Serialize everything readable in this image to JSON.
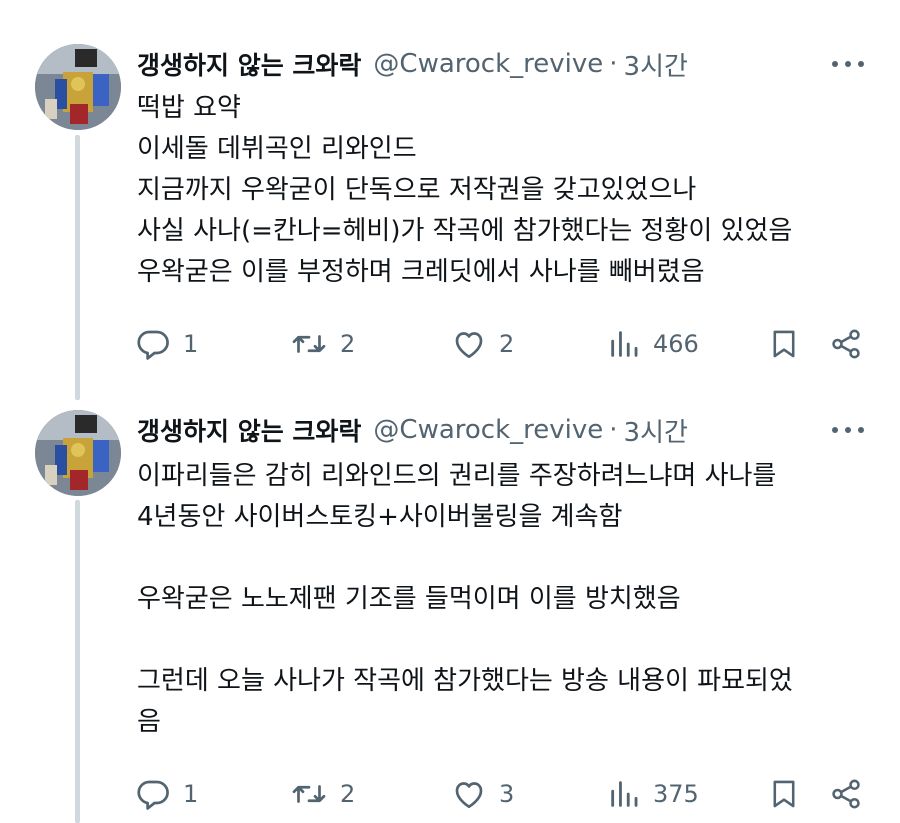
{
  "tweets": [
    {
      "name": "갱생하지 않는 크와락",
      "handle": "@Cwarock_revive",
      "separator": "·",
      "time": "3시간",
      "lines": [
        "떡밥 요약",
        "이세돌 데뷔곡인 리와인드",
        "지금까지 우왁굳이 단독으로 저작권을 갖고있었으나",
        "사실 사나(=칸나=헤비)가 작곡에 참가했다는 정황이 있었음",
        "우왁굳은 이를 부정하며 크레딧에서 사나를 빼버렸음"
      ],
      "replies": "1",
      "retweets": "2",
      "likes": "2",
      "views": "466"
    },
    {
      "name": "갱생하지 않는 크와락",
      "handle": "@Cwarock_revive",
      "separator": "·",
      "time": "3시간",
      "lines": [
        "이파리들은 감히 리와인드의 권리를 주장하려느냐며 사나를",
        "4년동안 사이버스토킹+사이버불링을 계속함",
        "",
        "우왁굳은 노노제팬 기조를 들먹이며 이를 방치했음",
        "",
        "그런데 오늘 사나가 작곡에 참가했다는 방송 내용이 파묘되었",
        "음"
      ],
      "replies": "1",
      "retweets": "2",
      "likes": "3",
      "views": "375"
    }
  ],
  "icons": {
    "reply": "reply-icon",
    "retweet": "retweet-icon",
    "like": "heart-icon",
    "views": "views-chart-icon",
    "bookmark": "bookmark-icon",
    "share": "share-icon",
    "more": "more-dots-icon"
  },
  "colors": {
    "text": "#0f1419",
    "secondary": "#536471",
    "thread_line": "#cfd9de"
  }
}
